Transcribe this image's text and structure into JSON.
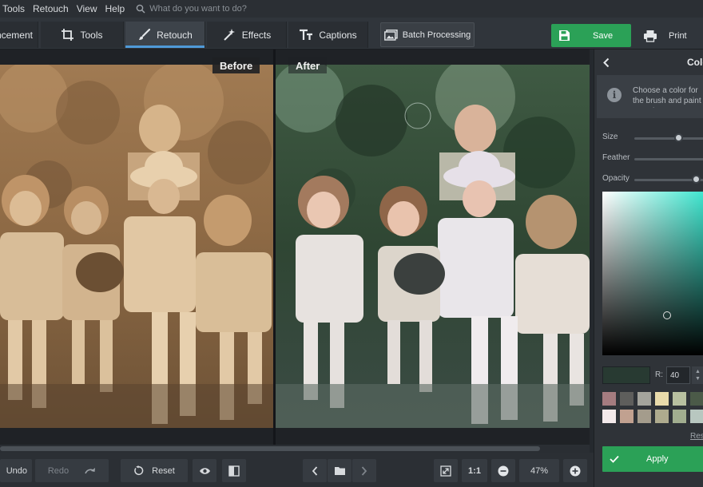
{
  "menu": {
    "items": [
      "Tools",
      "Retouch",
      "View",
      "Help"
    ],
    "search_placeholder": "What do you want to do?"
  },
  "toolbar": {
    "tabs": [
      {
        "label": "Enhancement",
        "icon": "enhance-icon"
      },
      {
        "label": "Tools",
        "icon": "crop-icon"
      },
      {
        "label": "Retouch",
        "icon": "brush-icon",
        "active": true
      },
      {
        "label": "Effects",
        "icon": "magic-wand-icon"
      },
      {
        "label": "Captions",
        "icon": "text-icon"
      }
    ],
    "batch_label": "Batch Processing",
    "save_label": "Save",
    "print_label": "Print"
  },
  "canvas": {
    "before_label": "Before",
    "after_label": "After"
  },
  "panel": {
    "title": "Colorize",
    "hint": "Choose a color for the brush and paint over the areas you want to colorize.",
    "size_label": "Size",
    "feather_label": "Feather",
    "opacity_label": "Opacity",
    "r_label": "R:",
    "r_value": "40",
    "swatches": [
      "#a57c80",
      "#5e5e5c",
      "#a4a49c",
      "#e9dbab",
      "#b8c0a0",
      "#4b5a48",
      "#f3e9ea",
      "#c1a190",
      "#a49c8c",
      "#aeab8e",
      "#a1ad8f",
      "#b8c7c0"
    ],
    "reset_label": "Reset",
    "apply_label": "Apply",
    "current_color": "#283a32"
  },
  "bottom": {
    "undo_label": "Undo",
    "redo_label": "Redo",
    "reset_label": "Reset",
    "zoom_1to1": "1:1",
    "zoom_level": "47%"
  },
  "colors": {
    "accent_green": "#2ba157",
    "active_tab_underline": "#4f9ad8"
  }
}
